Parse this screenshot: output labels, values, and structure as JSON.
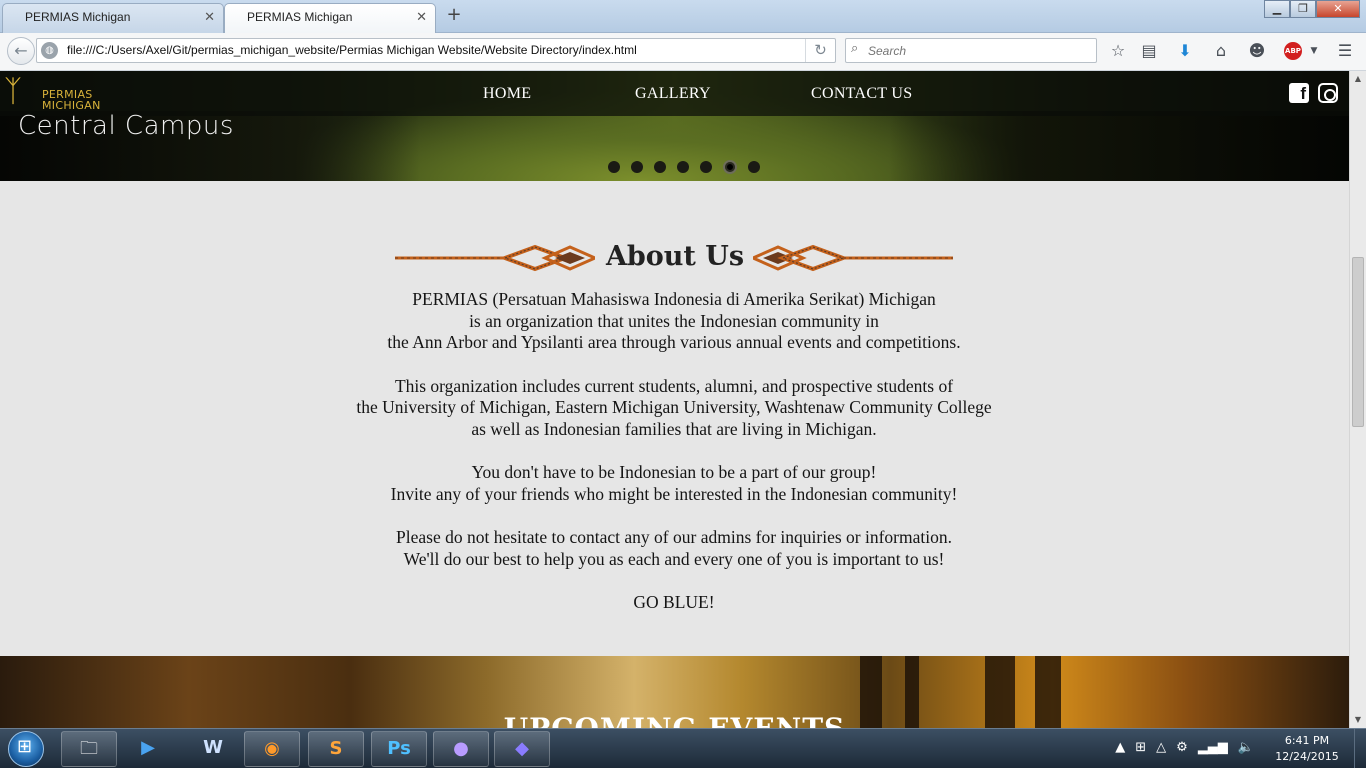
{
  "browser": {
    "tabs": [
      {
        "title": "PERMIAS Michigan"
      },
      {
        "title": "PERMIAS Michigan"
      }
    ],
    "url": "file:///C:/Users/Axel/Git/permias_michigan_website/Permias Michigan Website/Website Directory/index.html",
    "search_placeholder": "Search",
    "new_tab_glyph": "+",
    "close_glyph": "✕",
    "toolbar_icons": [
      "bookmark-star-icon",
      "reading-list-icon",
      "download-icon",
      "home-icon",
      "chat-icon",
      "adblock-icon",
      "menu-icon"
    ]
  },
  "site": {
    "logo_text": "PERMIAS\nMICHIGAN",
    "nav": [
      {
        "label": "HOME"
      },
      {
        "label": "GALLERY"
      },
      {
        "label": "CONTACT US"
      }
    ],
    "social": [
      "facebook-icon",
      "instagram-icon"
    ],
    "slider": {
      "caption": "Central Campus",
      "slide_count": 7,
      "active_slide": 6
    }
  },
  "about": {
    "title": "About Us",
    "paragraphs": [
      [
        "PERMIAS (Persatuan Mahasiswa Indonesia di Amerika Serikat) Michigan",
        "is an organization that unites the Indonesian community in",
        "the Ann Arbor and Ypsilanti area through various annual events and competitions."
      ],
      [
        "This organization includes current students, alumni, and prospective students of",
        "the University of Michigan, Eastern Michigan University, Washtenaw Community College",
        "as well as Indonesian families that are living in Michigan."
      ],
      [
        "You don't have to be Indonesian to be a part of our group!",
        "Invite any of your friends who might be interested in the Indonesian community!"
      ],
      [
        "Please do not hesitate to contact any of our admins for inquiries or information.",
        "We'll do our best to help you as each and every one of you is important to us!"
      ],
      [
        "GO BLUE!"
      ]
    ]
  },
  "events": {
    "title": "UPCOMING EVENTS"
  },
  "taskbar": {
    "time": "6:41 PM",
    "date": "12/24/2015"
  }
}
